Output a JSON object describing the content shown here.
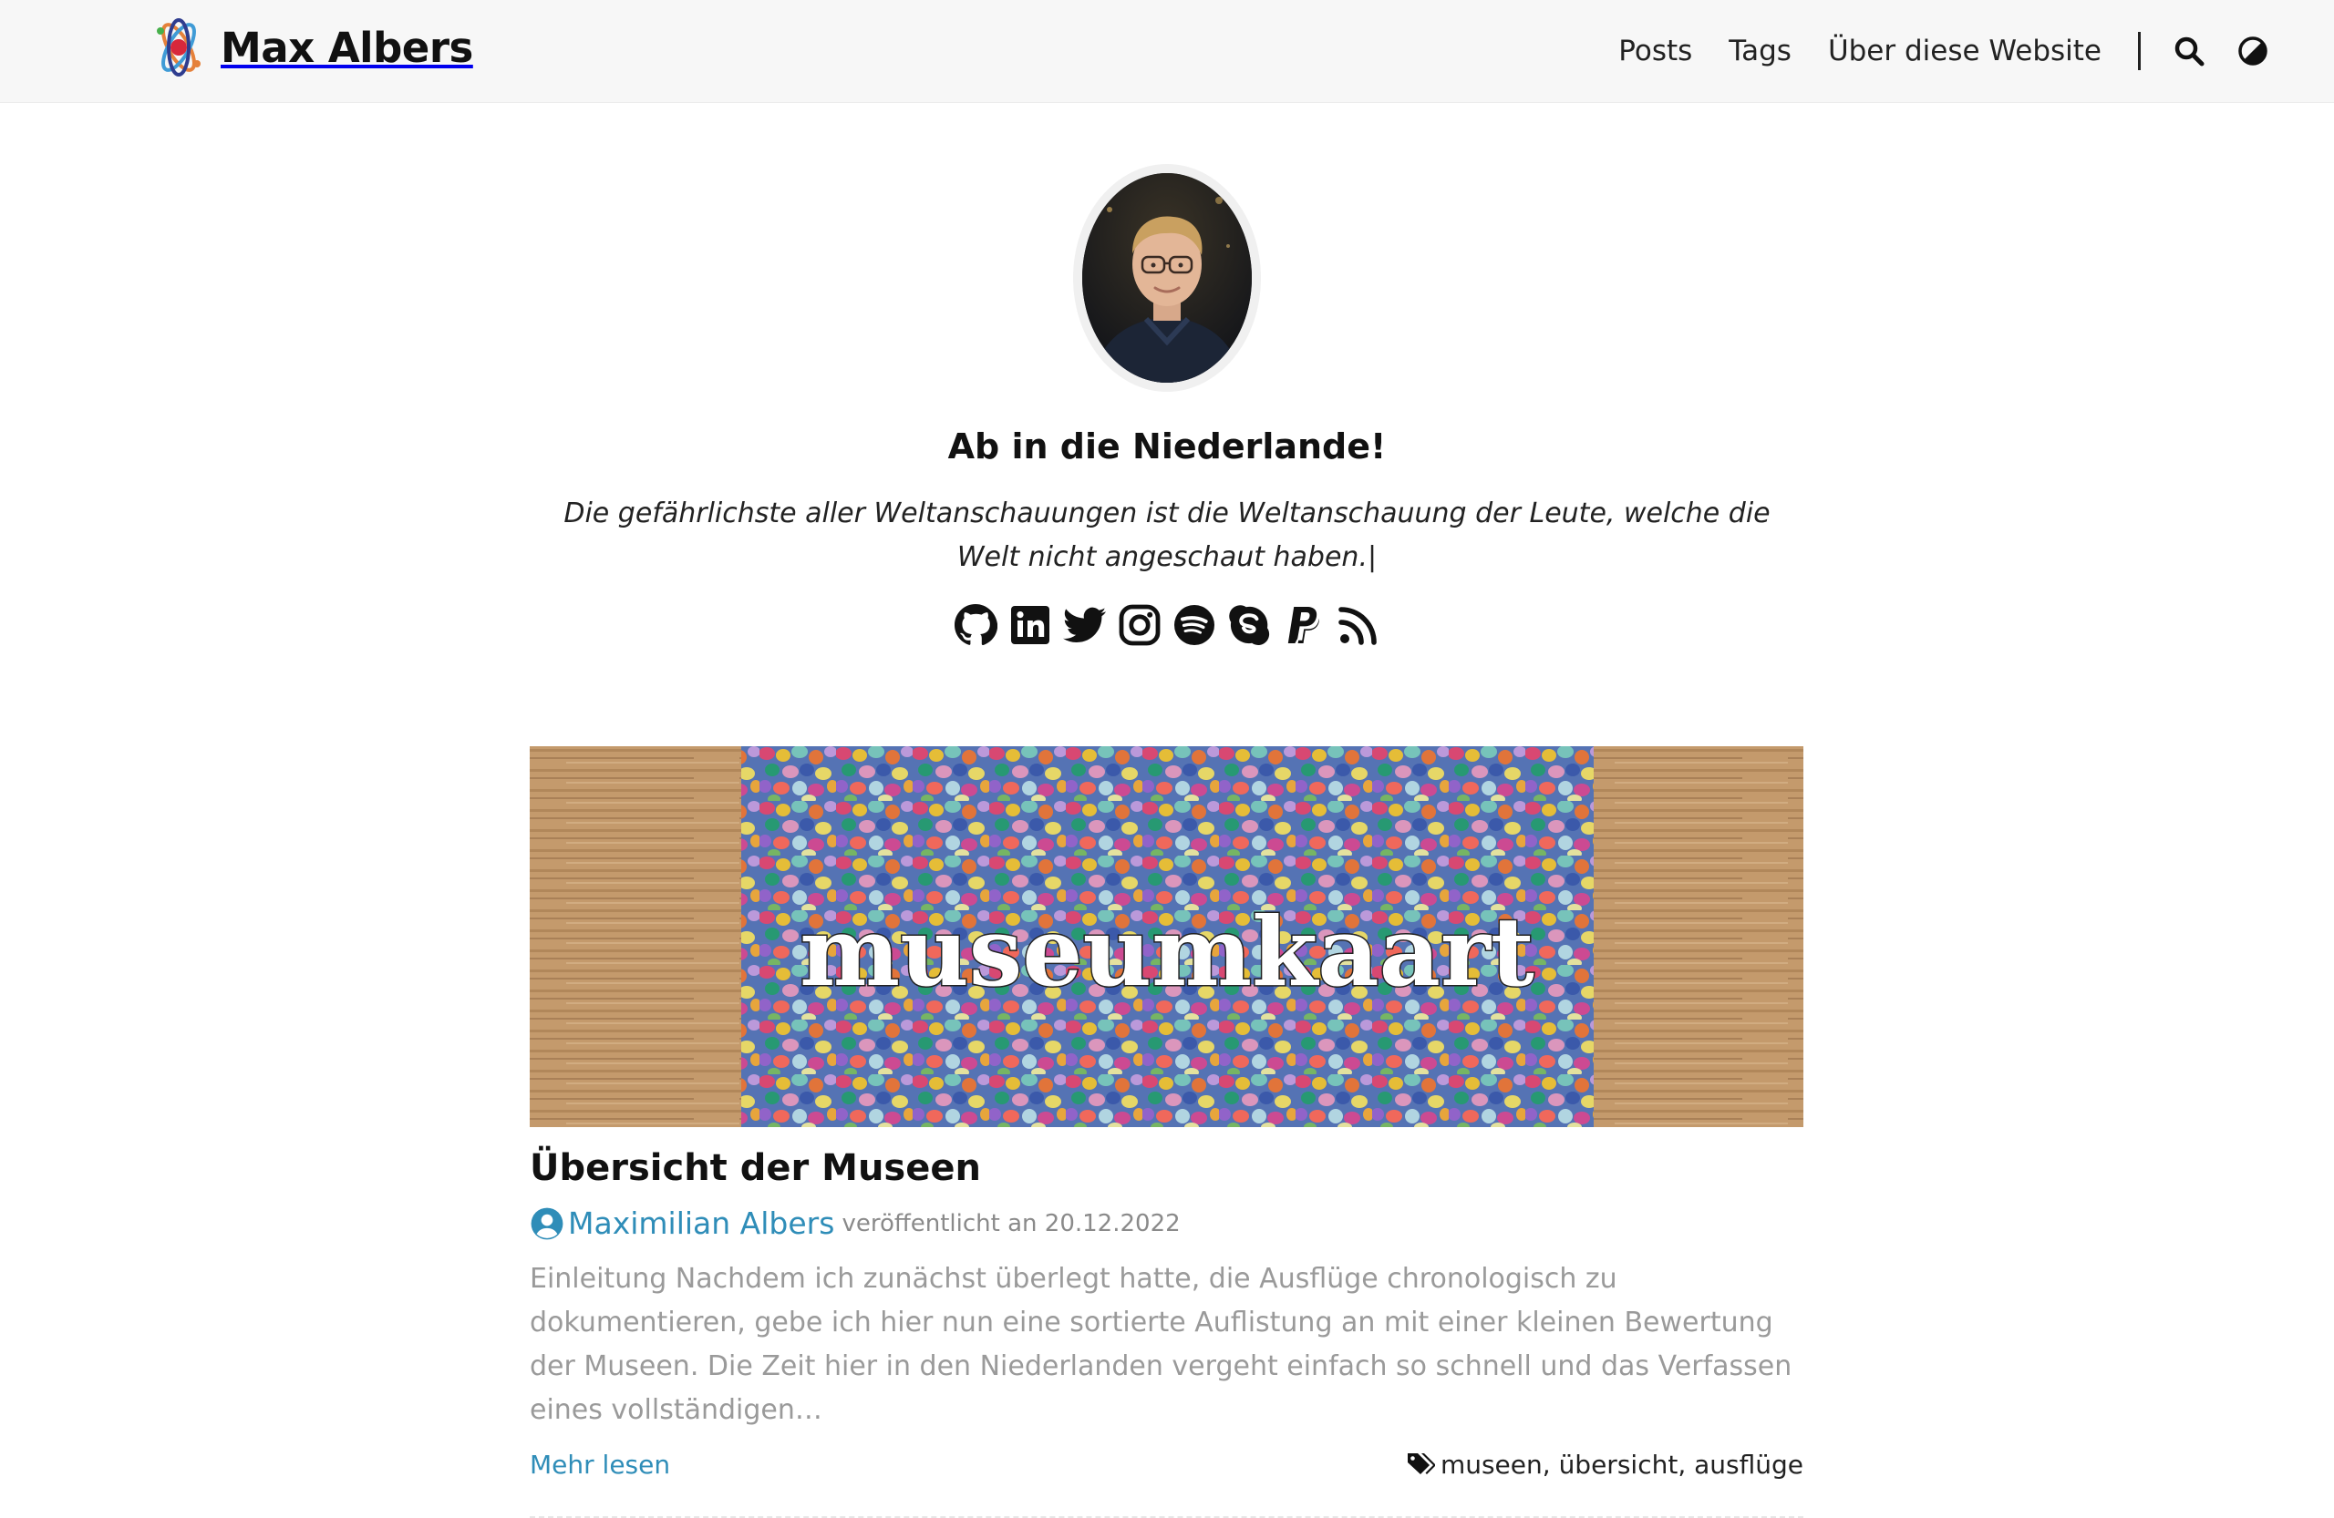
{
  "header": {
    "brand": "Max Albers",
    "nav": [
      "Posts",
      "Tags",
      "Über diese Website"
    ],
    "icons": [
      "search-icon",
      "theme-toggle-icon"
    ]
  },
  "profile": {
    "title": "Ab in die Niederlande!",
    "quote": "Die gefährlichste aller Weltanschauungen ist die Weltanschauung der Leute, welche die Welt nicht angeschaut haben.|",
    "social": [
      "github-icon",
      "linkedin-icon",
      "twitter-icon",
      "instagram-icon",
      "spotify-icon",
      "skype-icon",
      "paypal-icon",
      "rss-icon"
    ]
  },
  "post": {
    "cover_text": "museumkaart",
    "title": "Übersicht der Museen",
    "author": "Maximilian Albers",
    "published": "veröffentlicht an 20.12.2022",
    "excerpt": "Einleitung Nachdem ich zunächst überlegt hatte, die Ausflüge chronologisch zu dokumentieren, gebe ich hier nun eine sortierte Auflistung an mit einer kleinen Bewertung der Museen. Die Zeit hier in den Niederlanden vergeht einfach so schnell und das Verfassen eines vollständigen…",
    "readmore": "Mehr lesen",
    "tags": [
      "museen",
      "übersicht",
      "ausflüge"
    ]
  },
  "colors": {
    "link": "#2f8db8",
    "navbar_bg": "#f7f7f7"
  }
}
